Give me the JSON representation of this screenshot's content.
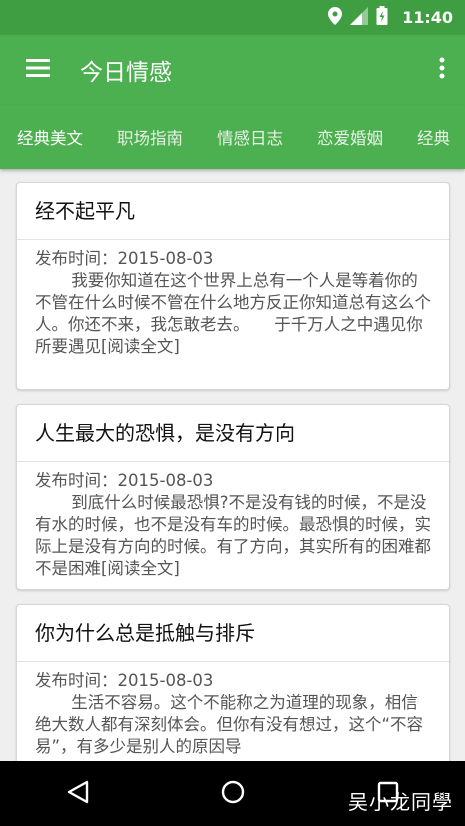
{
  "status_bar": {
    "time": "11:40"
  },
  "app_bar": {
    "title": "今日情感"
  },
  "tabs": [
    {
      "label": "经典美文",
      "active": true
    },
    {
      "label": "职场指南",
      "active": false
    },
    {
      "label": "情感日志",
      "active": false
    },
    {
      "label": "恋爱婚姻",
      "active": false
    },
    {
      "label": "经典",
      "active": false
    }
  ],
  "articles": [
    {
      "title": "经不起平凡",
      "date": "发布时间：2015-08-03",
      "summary": "我要你知道在这个世界上总有一个人是等着你的不管在什么时候不管在什么地方反正你知道总有这么个人。你还不来，我怎敢老去。　　于千万人之中遇见你所要遇见[阅读全文]"
    },
    {
      "title": "人生最大的恐惧，是没有方向",
      "date": "发布时间：2015-08-03",
      "summary": "到底什么时候最恐惧?不是没有钱的时候，不是没有水的时候，也不是没有车的时候。最恐惧的时候，实际上是没有方向的时候。有了方向，其实所有的困难都不是困难[阅读全文]"
    },
    {
      "title": "你为什么总是抵触与排斥",
      "date": "发布时间：2015-08-03",
      "summary": "生活不容易。这个不能称之为道理的现象，相信绝大数人都有深刻体会。但你有没有想过，这个“不容易”，有多少是别人的原因导"
    }
  ],
  "watermark": "吴小龙同學",
  "colors": {
    "app_bar": "#4caf50",
    "status_bar": "#3f9e41",
    "nav_bar": "#000000"
  },
  "icons": {
    "menu": "hamburger-menu-icon",
    "more": "more-vert-icon",
    "back": "back-triangle-icon",
    "home": "home-circle-icon",
    "recents": "recents-square-icon"
  }
}
